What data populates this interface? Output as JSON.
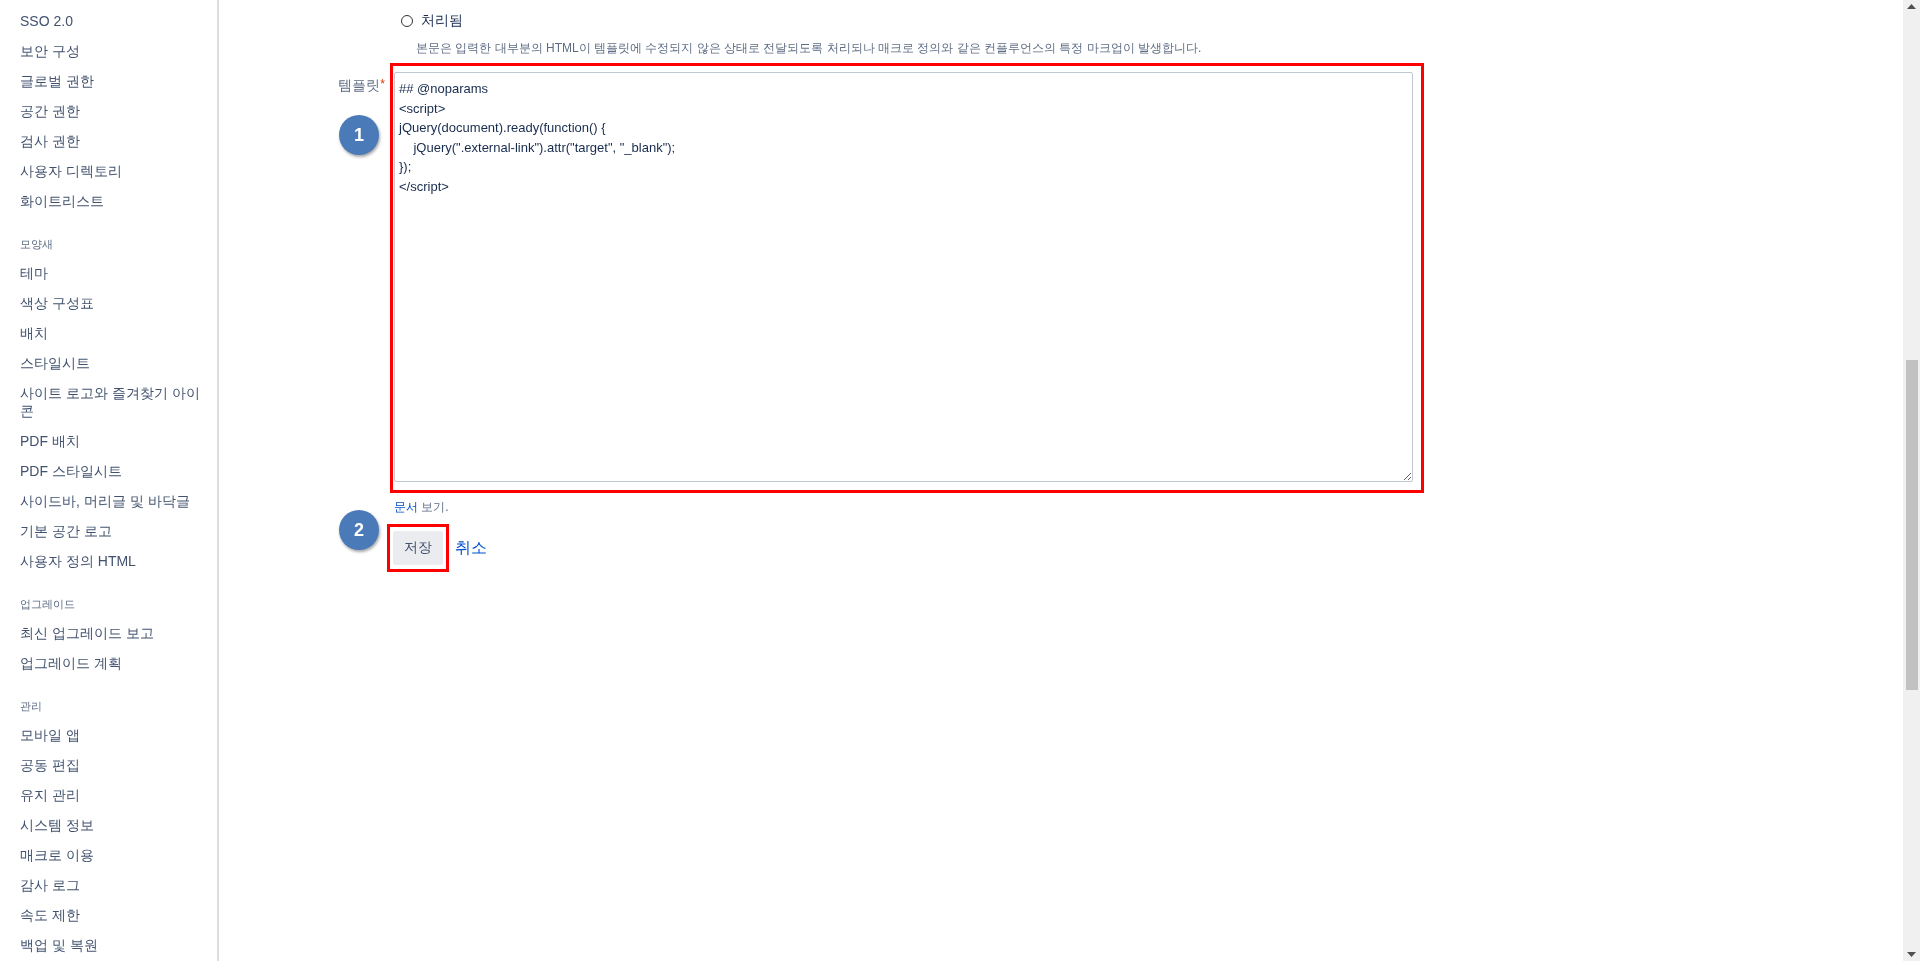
{
  "sidebar": {
    "sections": [
      {
        "items": [
          "SSO 2.0",
          "보안 구성",
          "글로벌 권한",
          "공간 권한",
          "검사 권한",
          "사용자 디렉토리",
          "화이트리스트"
        ]
      },
      {
        "heading": "모양새",
        "items": [
          "테마",
          "색상 구성표",
          "배치",
          "스타일시트",
          "사이트 로고와 즐겨찾기 아이콘",
          "PDF 배치",
          "PDF 스타일시트",
          "사이드바, 머리글 및 바닥글",
          "기본 공간 로고",
          "사용자 정의 HTML"
        ]
      },
      {
        "heading": "업그레이드",
        "items": [
          "최신 업그레이드 보고",
          "업그레이드 계획"
        ]
      },
      {
        "heading": "관리",
        "items": [
          "모바일 앱",
          "공동 편집",
          "유지 관리",
          "시스템 정보",
          "매크로 이용",
          "감사 로그",
          "속도 제한",
          "백업 및 복원"
        ]
      }
    ]
  },
  "form": {
    "option": {
      "label": "처리됨",
      "selected": false,
      "description": "본문은 입력한 대부분의 HTML이 템플릿에 수정되지 않은 상태로 전달되도록 처리되나 매크로 정의와 같은 컨플루언스의 특정 마크업이 발생합니다."
    },
    "template": {
      "label": "템플릿",
      "required_mark": "*",
      "value": "## @noparams\n<script>\njQuery(document).ready(function() {\n    jQuery(\".external-link\").attr(\"target\", \"_blank\");\n});\n</script>"
    },
    "help": {
      "link": "문서",
      "text": " 보기."
    },
    "buttons": {
      "save": "저장",
      "cancel": "취소"
    }
  },
  "annotations": [
    {
      "number": "1"
    },
    {
      "number": "2"
    }
  ]
}
